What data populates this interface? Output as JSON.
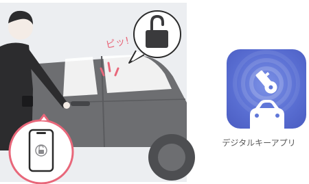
{
  "sound_effect": "ピッ!",
  "app": {
    "label": "デジタルキーアプリ",
    "icon": "key-car-icon",
    "gradient": [
      "#7d92e6",
      "#4a5cc1"
    ]
  },
  "icons": {
    "lock": "unlock-padlock-icon",
    "phone": "smartphone-unlock-icon"
  },
  "colors": {
    "car": "#6d6e71",
    "background_panel": "#eceef1",
    "accent_pink": "#e8677a",
    "app_blue": "#5a6fd3"
  }
}
